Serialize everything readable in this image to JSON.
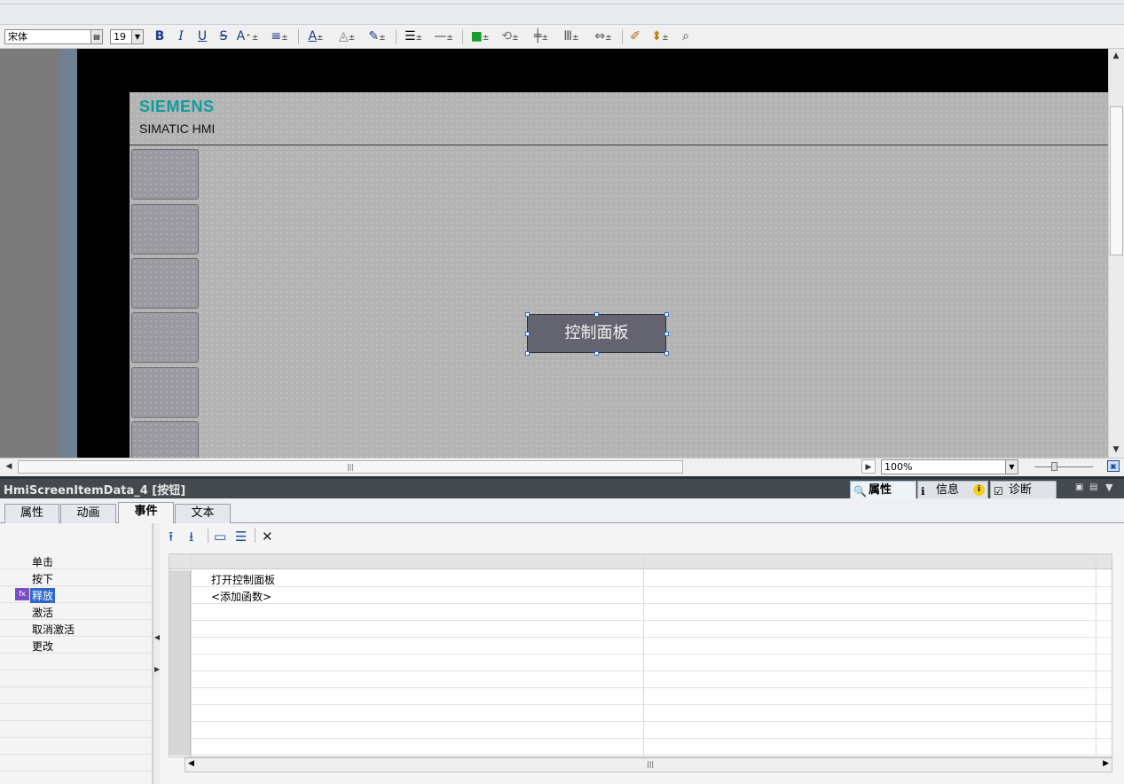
{
  "toolbar": {
    "font_name": "宋体",
    "font_size": "19",
    "bold": "B",
    "italic": "I",
    "underline": "U",
    "strike": "S",
    "fontsize_up": "A",
    "font_color": "A",
    "dropdown_glyph": "▾"
  },
  "hmi": {
    "logo": "SIEMENS",
    "subtitle": "SIMATIC HMI",
    "button_text": "控制面板",
    "logo_color": "#109c9c"
  },
  "canvas": {
    "zoom": "100%"
  },
  "inspector": {
    "title": "HmiScreenItemData_4 [按钮]",
    "panel_tabs": [
      {
        "label": "属性",
        "icon": "properties-icon"
      },
      {
        "label": "信息",
        "icon": "info-icon"
      },
      {
        "label": "诊断",
        "icon": "diagnostics-icon"
      }
    ],
    "tabs": [
      "属性",
      "动画",
      "事件",
      "文本"
    ],
    "active_tab": "事件"
  },
  "events": {
    "items": [
      "单击",
      "按下",
      "释放",
      "激活",
      "取消激活",
      "更改"
    ],
    "selected": "释放"
  },
  "functions": {
    "rows": [
      "打开控制面板",
      "<添加函数>"
    ]
  }
}
